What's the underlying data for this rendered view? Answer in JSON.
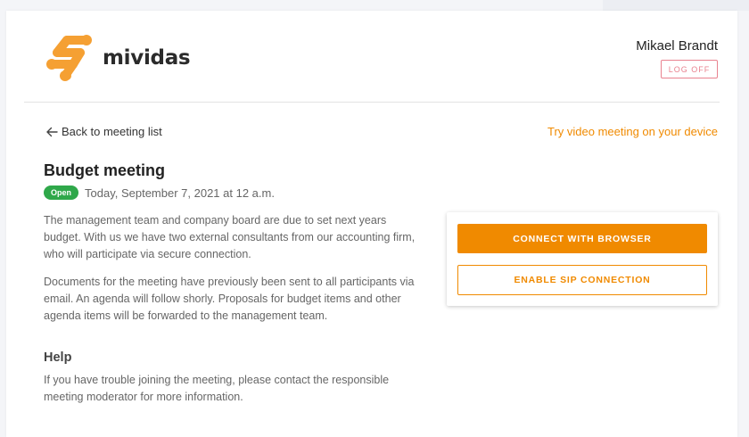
{
  "brand": {
    "name": "mividas",
    "accent_color": "#f08a00",
    "logo_color": "#f5a033"
  },
  "header": {
    "user_name": "Mikael Brandt",
    "logoff_label": "LOG OFF"
  },
  "nav": {
    "back_label": "Back to meeting list",
    "back_icon": "arrow-left-icon",
    "try_video_label": "Try video meeting on your device"
  },
  "meeting": {
    "title": "Budget meeting",
    "status": "Open",
    "status_color": "#2fa84a",
    "date": "Today, September 7, 2021 at 12 a.m.",
    "description_1": "The management team and company board are due to set next years budget. With us we have two external consultants from our accounting firm, who will participate via secure connection.",
    "description_2": "Documents for the meeting have previously been sent to all participants via email. An agenda will follow shorly. Proposals for budget items and other agenda items will be forwarded to the management team."
  },
  "help": {
    "title": "Help",
    "text": "If you have trouble joining the meeting, please contact the responsible meeting moderator for more information."
  },
  "connect": {
    "browser_label": "CONNECT WITH BROWSER",
    "sip_label": "ENABLE SIP CONNECTION"
  }
}
